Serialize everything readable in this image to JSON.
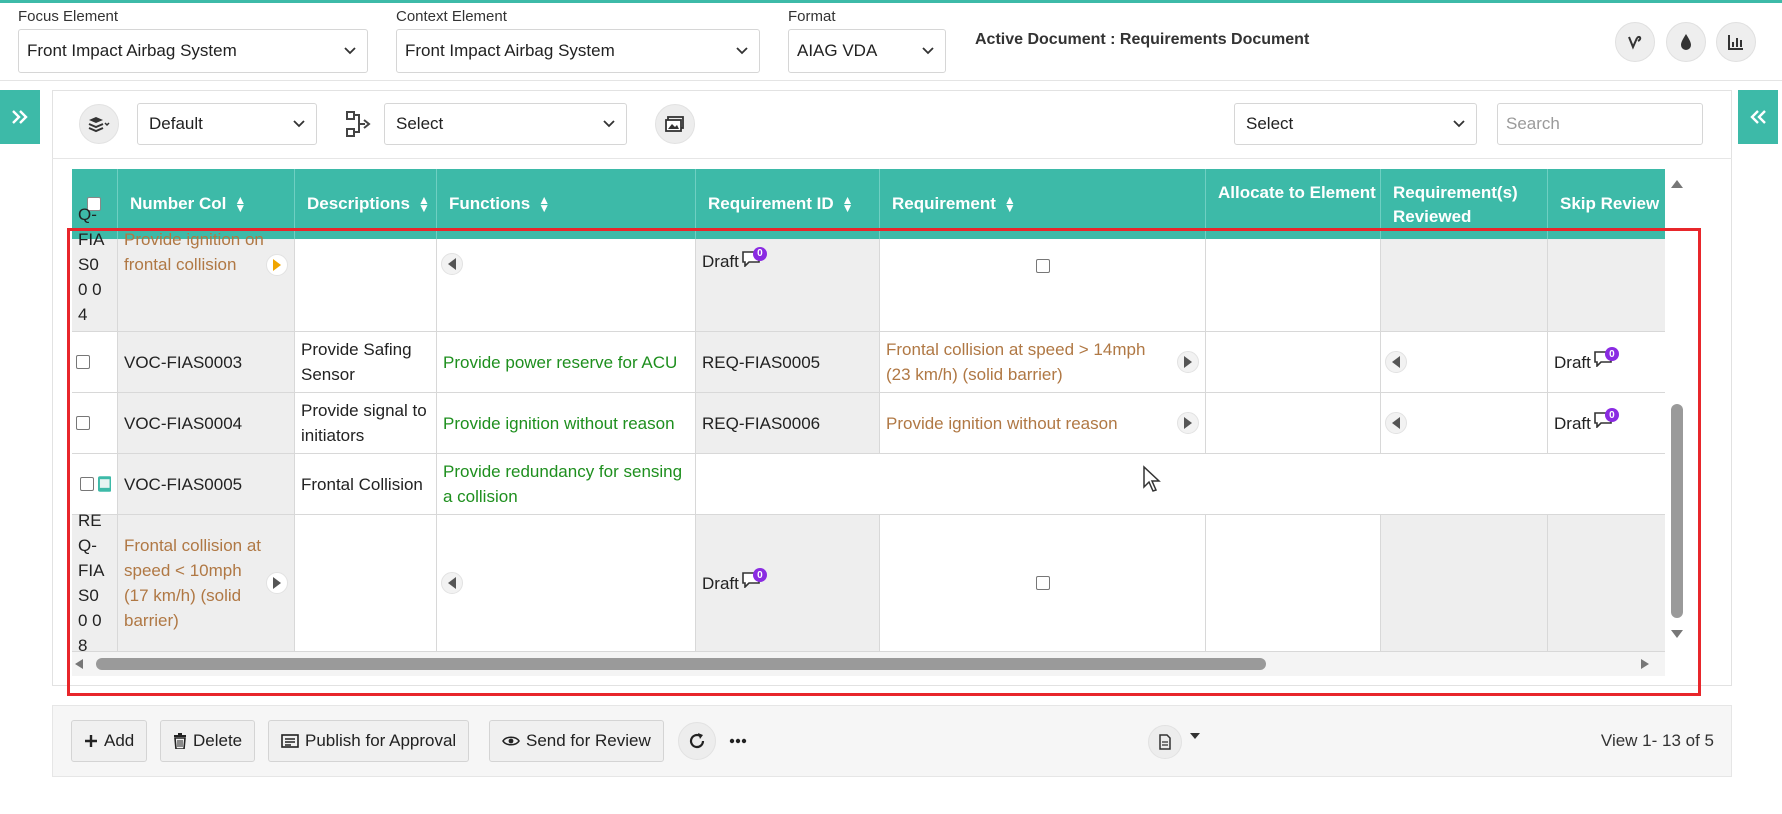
{
  "header": {
    "focus_label": "Focus Element",
    "focus_value": "Front Impact Airbag System",
    "context_label": "Context Element",
    "context_value": "Front Impact Airbag System",
    "format_label": "Format",
    "format_value": "AIAG VDA",
    "active_document": "Active Document : Requirements Document",
    "icons": [
      "vine-icon",
      "drop-icon",
      "chart-icon"
    ]
  },
  "toolbar": {
    "view_select": "Default",
    "flow_select": "Select",
    "filter_select": "Select",
    "search_placeholder": "Search"
  },
  "columns": {
    "number": "Number Col",
    "descriptions": "Descriptions",
    "functions": "Functions",
    "requirement_id": "Requirement ID",
    "requirement": "Requirement",
    "allocate": "Allocate to Element",
    "reviewed": "Requirement(s) Reviewed",
    "skip_review": "Skip Review"
  },
  "rows": {
    "r1": {
      "id_partial": "Q-FIA S00 04",
      "number_text": "Provide ignition on frontal collision",
      "status": "Draft",
      "comments": "0"
    },
    "r2": {
      "number": "VOC-FIAS0003",
      "description": "Provide Safing Sensor",
      "function": "Provide power reserve for ACU",
      "req_id": "REQ-FIAS0005",
      "requirement": "Frontal collision at speed > 14mph (23 km/h) (solid barrier)",
      "status": "Draft",
      "comments": "0"
    },
    "r3": {
      "number": "VOC-FIAS0004",
      "description": "Provide signal to initiators",
      "function": "Provide ignition without reason",
      "req_id": "REQ-FIAS0006",
      "requirement": "Provide ignition without reason",
      "status": "Draft",
      "comments": "0"
    },
    "r4": {
      "number": "VOC-FIAS0005",
      "description": "Frontal Collision",
      "function": "Provide redundancy for sensing a collision"
    },
    "r5": {
      "id_partial": "RE Q-FIA S00 08",
      "number_text": "Frontal collision at speed < 10mph (17 km/h) (solid barrier)",
      "status": "Draft",
      "comments": "0"
    }
  },
  "bottom": {
    "add": "Add",
    "delete": "Delete",
    "publish": "Publish for Approval",
    "send_review": "Send for Review",
    "view_info": "View 1- 13 of 5"
  },
  "colors": {
    "accent": "#3dbaa8",
    "highlight": "#e8262b",
    "green_text": "#1e8f1e",
    "brown_text": "#b07844",
    "badge": "#8a2be2"
  }
}
